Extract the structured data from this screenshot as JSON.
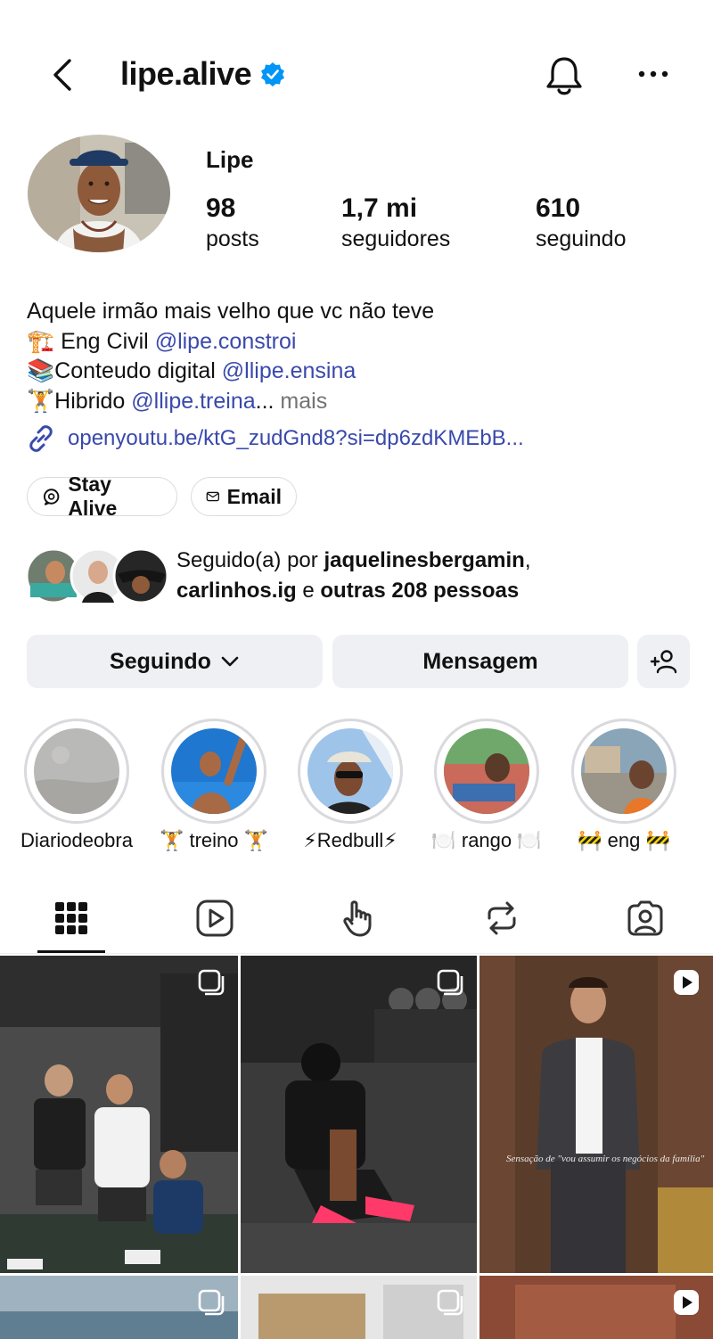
{
  "header": {
    "username": "lipe.alive",
    "verified": true,
    "icons": [
      "back-arrow-icon",
      "verified-badge-icon",
      "bell-icon",
      "more-icon"
    ]
  },
  "profile": {
    "display_name": "Lipe",
    "stats": [
      {
        "value": "98",
        "label": "posts"
      },
      {
        "value": "1,7 mi",
        "label": "seguidores"
      },
      {
        "value": "610",
        "label": "seguindo"
      }
    ]
  },
  "bio": {
    "line1": "Aquele irmão mais velho que vc não teve",
    "line2_emoji": "🏗️",
    "line2_text": " Eng Civil ",
    "line2_mention": "@lipe.constroi",
    "line3_emoji": "📚",
    "line3_text": "Conteudo digital ",
    "line3_mention": "@llipe.ensina",
    "line4_emoji": "🏋️",
    "line4_text": "Hibrido ",
    "line4_mention": "@llipe.treina",
    "line4_ellipsis": "...",
    "line4_more": " mais",
    "link": "openyoutu.be/ktG_zudGnd8?si=dp6zdKMEbB..."
  },
  "chips": [
    {
      "label": "Stay Alive",
      "icon": "threads-icon"
    },
    {
      "label": "Email",
      "icon": "mail-icon"
    }
  ],
  "followed_by": {
    "prefix": "Seguido(a) por ",
    "user1": "jaquelinesbergamin",
    "comma": ",",
    "user2": "carlinhos.ig",
    "conj": " e ",
    "others": "outras 208 pessoas"
  },
  "actions": {
    "following_label": "Seguindo",
    "message_label": "Mensagem"
  },
  "highlights": [
    {
      "label": "Diariodeobra"
    },
    {
      "label": "🏋️ treino 🏋️"
    },
    {
      "label": "⚡Redbull⚡"
    },
    {
      "label": "🍽️ rango 🍽️"
    },
    {
      "label": "🚧 eng 🚧"
    }
  ],
  "tabs": [
    "grid-icon",
    "reels-icon",
    "tap-icon",
    "reposts-icon",
    "tagged-icon"
  ],
  "posts": [
    {
      "type": "carousel"
    },
    {
      "type": "carousel"
    },
    {
      "type": "reel",
      "caption": "Sensação de \"vou assumir os negócios da família\""
    },
    {
      "type": "carousel"
    },
    {
      "type": "carousel"
    },
    {
      "type": "reel"
    }
  ],
  "colors": {
    "link": "#3949ab",
    "button_bg": "#eef0f3",
    "verified": "#0095f6"
  }
}
